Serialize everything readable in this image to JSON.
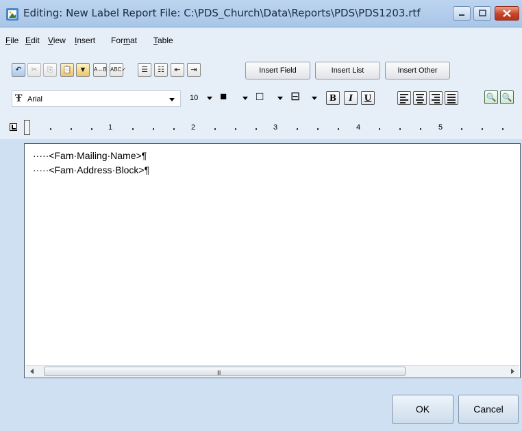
{
  "window": {
    "title": "Editing: New Label Report   File: C:\\PDS_Church\\Data\\Reports\\PDS\\PDS1203.rtf"
  },
  "menu": [
    {
      "pre": "",
      "acc": "F",
      "post": "ile"
    },
    {
      "pre": "",
      "acc": "E",
      "post": "dit"
    },
    {
      "pre": "",
      "acc": "V",
      "post": "iew"
    },
    {
      "pre": "",
      "acc": "I",
      "post": "nsert"
    },
    {
      "pre": "For",
      "acc": "m",
      "post": "at"
    },
    {
      "pre": "",
      "acc": "T",
      "post": "able"
    }
  ],
  "toolbar": {
    "insert_field": "Insert Field",
    "insert_list": "Insert List",
    "insert_other": "Insert Other",
    "icons": [
      "undo-icon",
      "cut-icon",
      "copy-icon",
      "paste-icon",
      "format-painter-icon",
      "find-replace-icon",
      "spell-check-icon",
      "bullet-list-icon",
      "numbered-list-icon",
      "decrease-indent-icon",
      "increase-indent-icon"
    ]
  },
  "format": {
    "font_name": "Arial",
    "font_size": "10",
    "bold_label": "B",
    "italic_label": "I",
    "underline_label": "U"
  },
  "ruler": {
    "numbers": [
      "1",
      "2",
      "3",
      "4",
      "5"
    ]
  },
  "document": {
    "lines": [
      "·····<Fam·Mailing·Name>¶",
      "·····<Fam·Address·Block>¶"
    ]
  },
  "scrollbar": {
    "grip": "III"
  },
  "buttons": {
    "ok": "OK",
    "cancel": "Cancel"
  },
  "colors": {
    "title_bar": "#a9c6e8",
    "close_button": "#c8432a",
    "toolbar_bg": "#e6eef8"
  }
}
